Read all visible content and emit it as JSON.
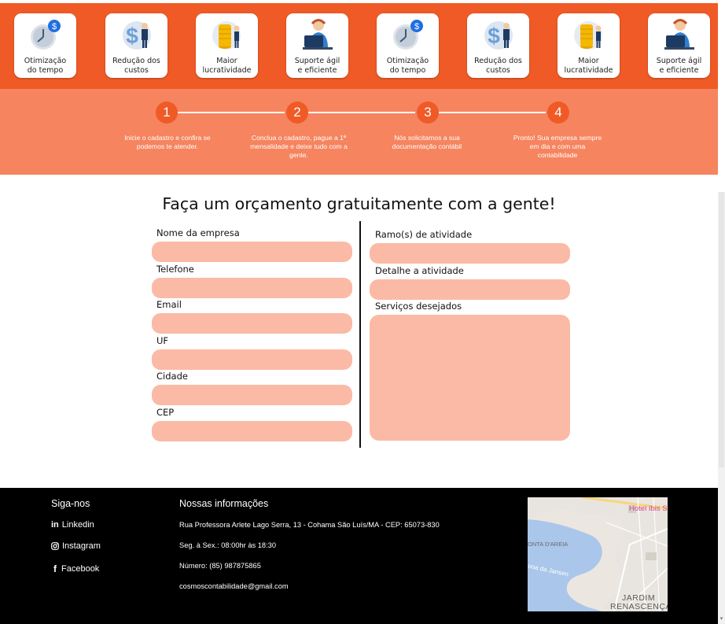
{
  "benefits": [
    {
      "label": "Otimização\ndo tempo",
      "icon": "clock-dollar-icon"
    },
    {
      "label": "Redução dos\ncustos",
      "icon": "dollar-man-icon"
    },
    {
      "label": "Maior\nlucratividade",
      "icon": "coins-man-icon"
    },
    {
      "label": "Suporte ágil\ne eficiente",
      "icon": "support-agent-icon"
    },
    {
      "label": "Otimização\ndo tempo",
      "icon": "clock-dollar-icon"
    },
    {
      "label": "Redução dos\ncustos",
      "icon": "dollar-man-icon"
    },
    {
      "label": "Maior\nlucratividade",
      "icon": "coins-man-icon"
    },
    {
      "label": "Suporte ágil\ne eficiente",
      "icon": "support-agent-icon"
    }
  ],
  "steps": [
    {
      "number": "1",
      "text": "Inicie o cadastro e confira se podemos te atender."
    },
    {
      "number": "2",
      "text": "Conclua o cadastro, pague a 1ª mensalidade e deixe tudo com a gente."
    },
    {
      "number": "3",
      "text": "Nós solicitamos a sua documentação contábil"
    },
    {
      "number": "4",
      "text": "Pronto! Sua empresa sempre em dia e com uma contabilidade"
    }
  ],
  "form": {
    "title": "Faça um orçamento gratuitamente com a gente!",
    "left_fields": [
      {
        "label": "Nome da empresa",
        "value": ""
      },
      {
        "label": "Telefone",
        "value": ""
      },
      {
        "label": "Email",
        "value": ""
      },
      {
        "label": "UF",
        "value": ""
      },
      {
        "label": "Cidade",
        "value": ""
      },
      {
        "label": "CEP",
        "value": ""
      }
    ],
    "right_fields": [
      {
        "label": "Ramo(s) de atividade",
        "value": ""
      },
      {
        "label": "Detalhe a atividade",
        "value": ""
      }
    ],
    "services": {
      "label": "Serviços desejados",
      "value": ""
    }
  },
  "footer": {
    "social_title": "Siga-nos",
    "social_links": [
      {
        "label": "Linkedin",
        "icon": "linkedin-icon"
      },
      {
        "label": "Instagram",
        "icon": "instagram-icon"
      },
      {
        "label": "Facebook",
        "icon": "facebook-icon"
      }
    ],
    "info_title": "Nossas informações",
    "address": "Rua Professora Arlete Lago Serra, 13 - Cohama São Luís/MA - CEP: 65073-830",
    "hours": "Seg. à Sex.: 08:00hr às 18:30",
    "phone": "Número: (85) 987875865",
    "email": "cosmoscontabilidade@gmail.com",
    "map_labels": {
      "hotel": "Hotel Ibis S",
      "area": "ONTA D'AREIA",
      "bay": "ooa da Jansen",
      "district_1": "JARDIM",
      "district_2": "RENASCENÇA"
    }
  },
  "colors": {
    "brand_orange": "#f05a26",
    "steps_band": "#f5845f",
    "field_fill": "#fbbaa5",
    "footer_bg": "#000000"
  }
}
